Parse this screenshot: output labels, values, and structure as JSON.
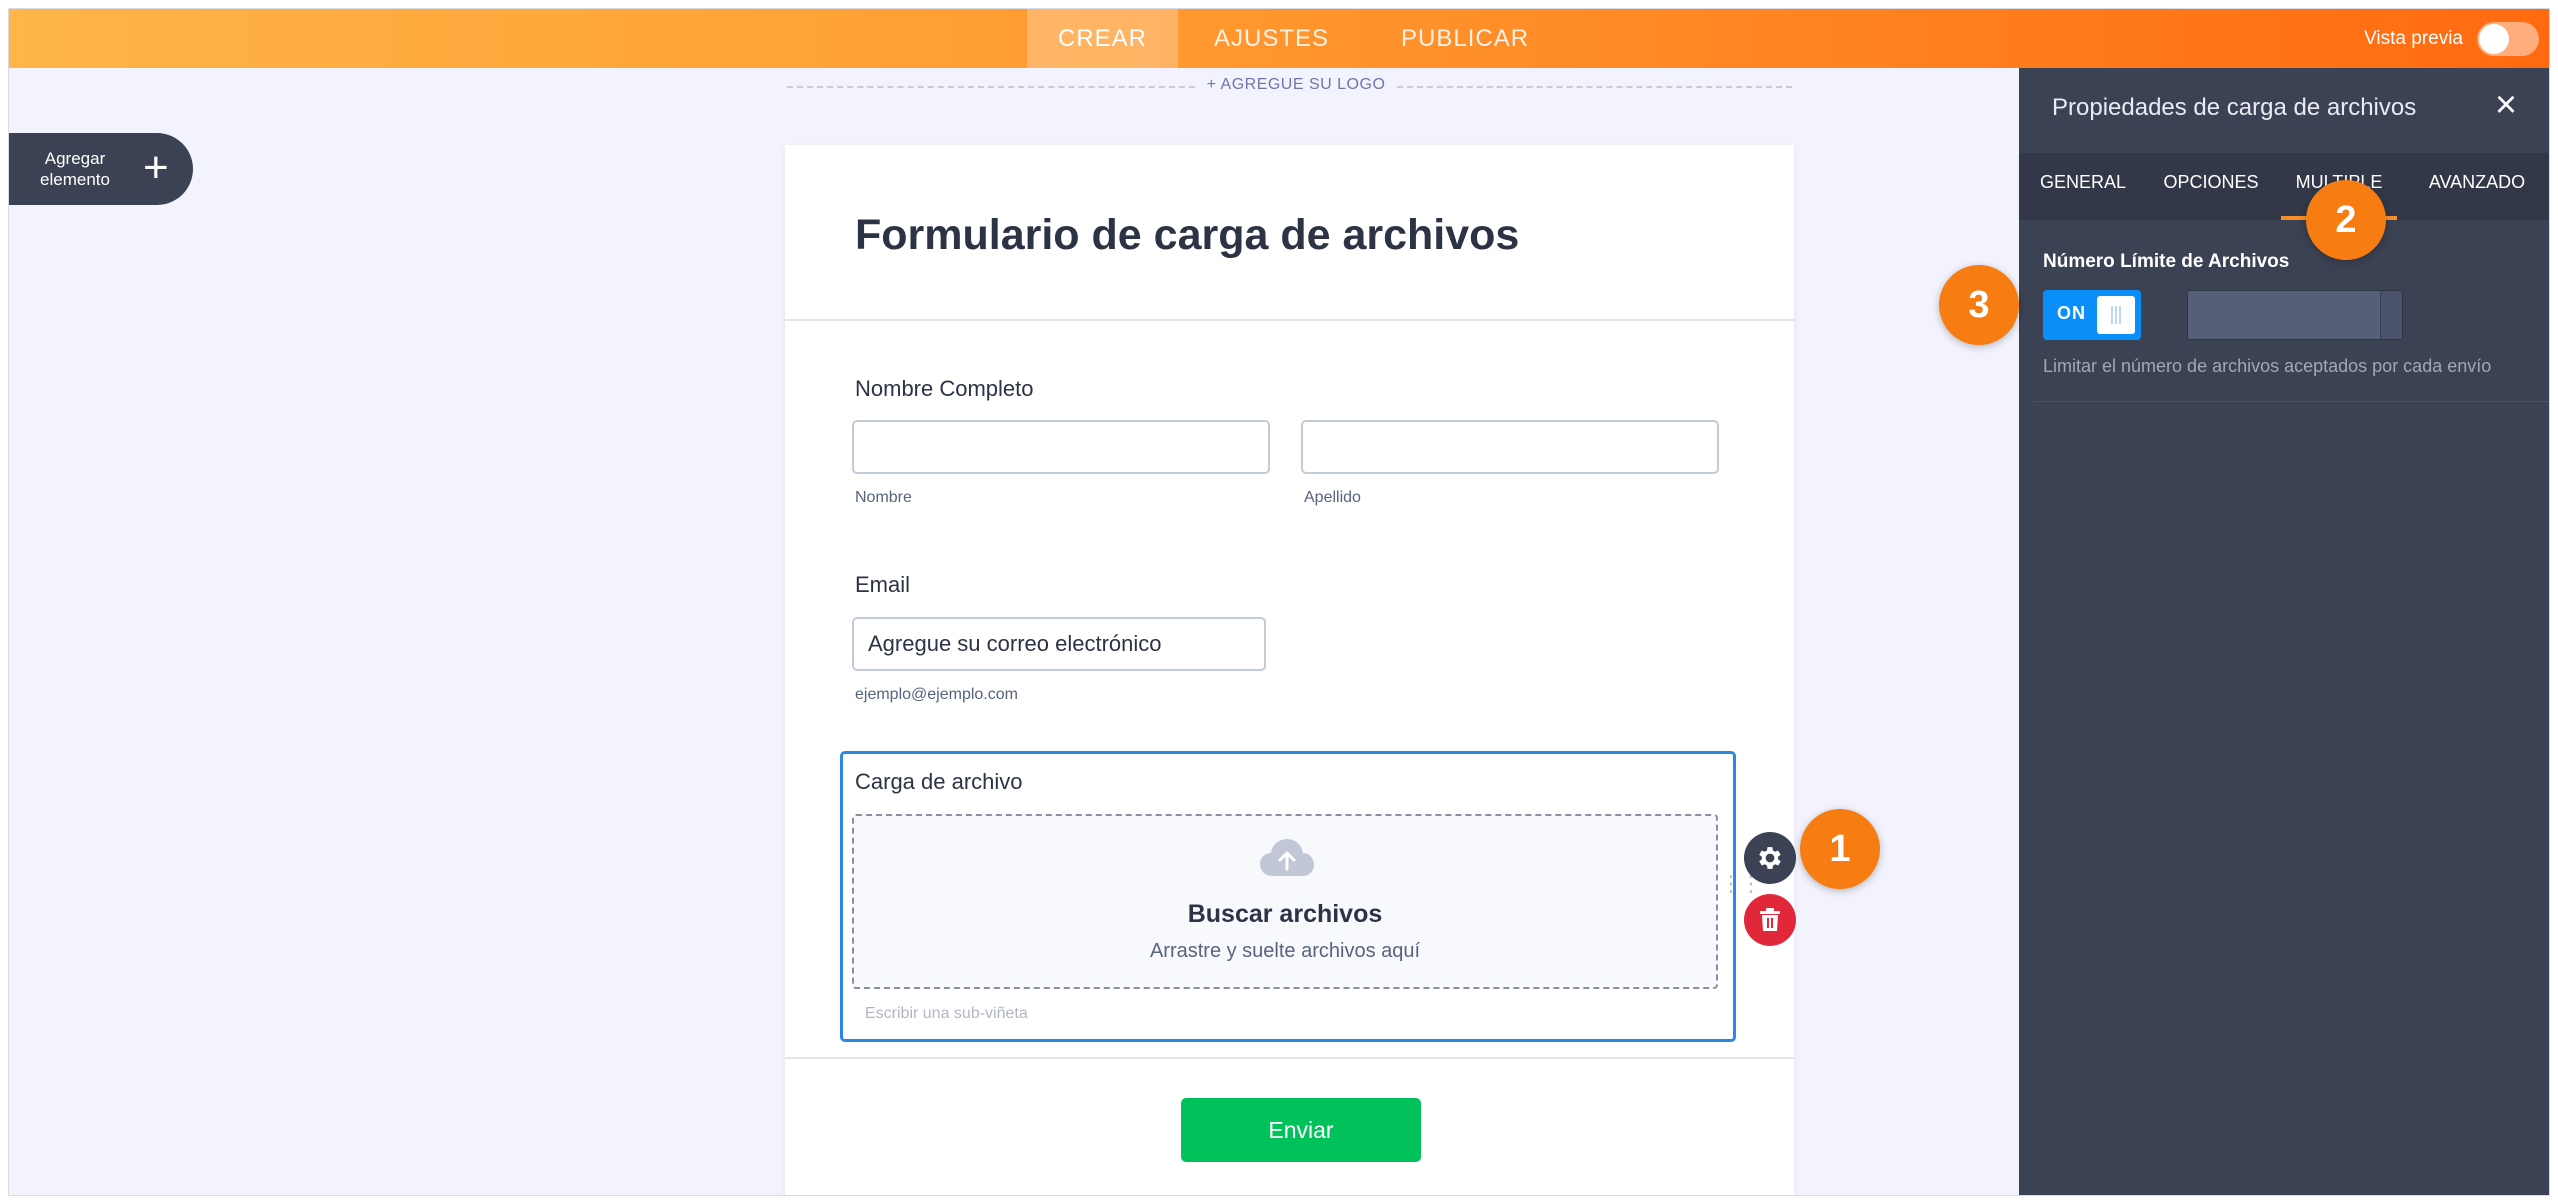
{
  "topbar": {
    "tabs": [
      "CREAR",
      "AJUSTES",
      "PUBLICAR"
    ],
    "active_tab": "CREAR",
    "preview_label": "Vista previa",
    "preview_on": false
  },
  "logo_prompt": "+ AGREGUE SU LOGO",
  "add_element": {
    "label_line1": "Agregar",
    "label_line2": "elemento",
    "icon": "plus-icon"
  },
  "form": {
    "title": "Formulario de carga de archivos",
    "full_name": {
      "label": "Nombre Completo",
      "first_sub": "Nombre",
      "last_sub": "Apellido",
      "first_value": "",
      "last_value": ""
    },
    "email": {
      "label": "Email",
      "value": "Agregue su correo electrónico",
      "sub": "ejemplo@ejemplo.com"
    },
    "upload": {
      "label": "Carga de archivo",
      "icon": "cloud-upload-icon",
      "title": "Buscar archivos",
      "subtitle": "Arrastre y suelte archivos aquí",
      "sublabel_placeholder": "Escribir una sub-viñeta"
    },
    "submit_label": "Enviar"
  },
  "field_actions": {
    "settings_icon": "gear-icon",
    "delete_icon": "trash-icon"
  },
  "steps": [
    "1",
    "2",
    "3"
  ],
  "panel": {
    "title": "Propiedades de carga de archivos",
    "close_icon": "close-icon",
    "tabs": [
      "GENERAL",
      "OPCIONES",
      "MULTIPLE",
      "AVANZADO"
    ],
    "active_tab": "MULTIPLE",
    "limit": {
      "title": "Número Límite de Archivos",
      "toggle_text": "ON",
      "value": "",
      "description": "Limitar el número de archivos aceptados por cada envío"
    }
  },
  "colors": {
    "accent_orange": "#ff7a1a",
    "step_badge": "#f77c12",
    "selected_field": "#2b86e6",
    "submit_green": "#00c15a",
    "toggle_blue": "#0a8ff8",
    "panel_bg": "#3b4253",
    "delete_red": "#e0283a"
  }
}
